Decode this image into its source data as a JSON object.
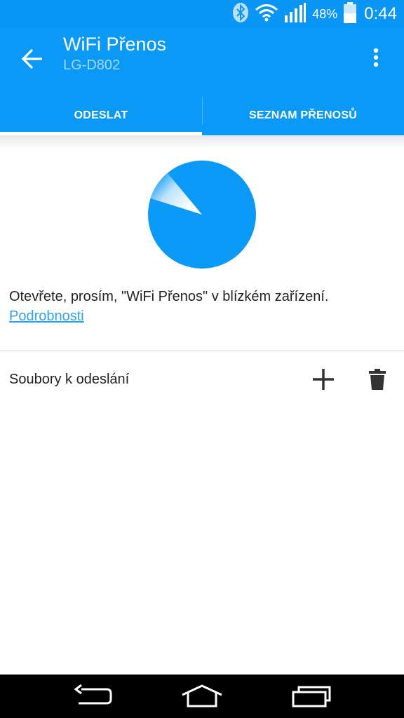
{
  "status_bar": {
    "battery_percent": "48%",
    "time": "0:44",
    "icons": [
      "bluetooth-icon",
      "wifi-icon",
      "signal-icon",
      "battery-icon"
    ]
  },
  "header": {
    "title": "WiFi Přenos",
    "subtitle": "LG-D802",
    "back_icon": "arrow-back-icon",
    "overflow_icon": "more-vert-icon"
  },
  "tabs": [
    {
      "label": "ODESLAT",
      "active": true
    },
    {
      "label": "SEZNAM PŘENOSŮ",
      "active": false
    }
  ],
  "main": {
    "message": "Otevřete, prosím, \"WiFi Přenos\" v blízkém zařízení.",
    "details_link": "Podrobnosti",
    "files_label": "Soubory k odeslání",
    "add_icon": "plus-icon",
    "delete_icon": "trash-icon"
  },
  "nav_bar": {
    "icons": [
      "back-nav-icon",
      "home-nav-icon",
      "recents-nav-icon"
    ]
  },
  "colors": {
    "accent": "#0a99f7",
    "link": "#2aa4e8"
  }
}
